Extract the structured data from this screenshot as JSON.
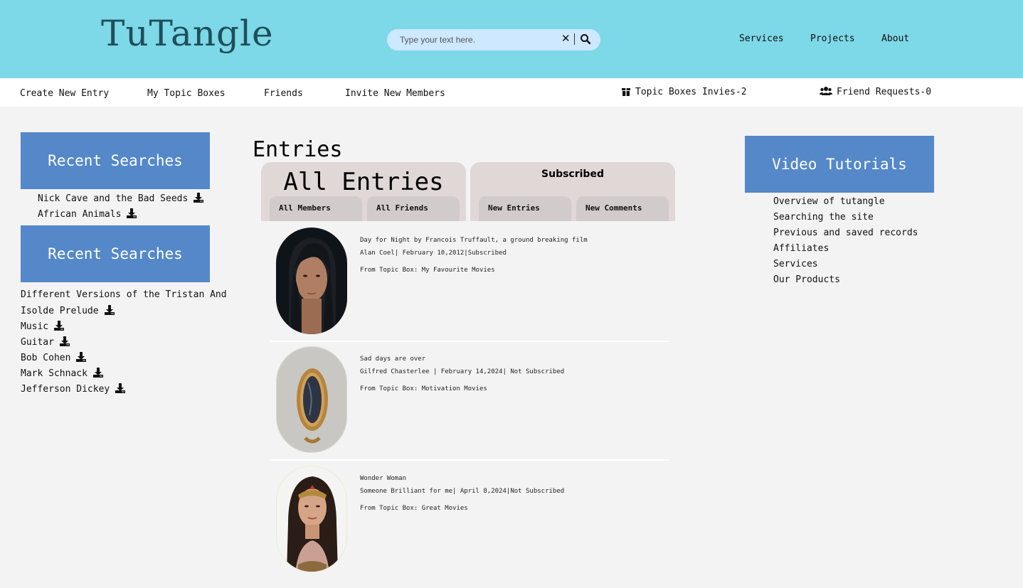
{
  "header": {
    "logo": "TuTangle",
    "search_placeholder": "Type your text here.",
    "nav": [
      "Services",
      "Projects",
      "About"
    ]
  },
  "subnav": {
    "create": "Create New Entry",
    "my_topic_boxes": "My Topic Boxes",
    "friends": "Friends",
    "invite": "Invite New Members",
    "topic_invites": "Topic Boxes Invies-2",
    "friend_requests": "Friend Requests-0"
  },
  "left": {
    "box1_title": "Recent Searches",
    "box1_items": [
      "Nick Cave and the Bad Seeds",
      "African Animals"
    ],
    "box2_title": "Recent Searches",
    "box2_items": [
      "Different Versions of the Tristan And",
      "Isolde Prelude",
      "Music",
      "Guitar",
      "Bob Cohen",
      "Mark Schnack",
      "Jefferson Dickey"
    ]
  },
  "entries": {
    "heading": "Entries",
    "panel_all": "All Entries",
    "panel_subscribed": "Subscribed",
    "tabs": [
      "All Members",
      "All Friends",
      "New Entries",
      "New Comments"
    ],
    "items": [
      {
        "title": "Day for Night by Francois Truffault, a ground breaking film",
        "meta": "Alan Coel| February 10,2012|Subscribed",
        "from": "From Topic Box: My Favourite Movies"
      },
      {
        "title": "Sad days are over",
        "meta": "Gilfred Chasterlee | February 14,2024| Not Subscribed",
        "from": "From Topic Box: Motivation Movies"
      },
      {
        "title": "Wonder Woman",
        "meta": "Someone Brilliant for me| April 8,2024|Not Subscribed",
        "from": "From Topic Box: Great Movies"
      }
    ]
  },
  "right": {
    "title": "Video Tutorials",
    "links": [
      "Overview of tutangle",
      "Searching the site",
      "Previous and saved records",
      "Affiliates",
      "Services",
      "Our Products"
    ]
  },
  "colors": {
    "header_bg": "#7dd8e8",
    "accent_blue": "#5488c8",
    "panel_bg": "#e0d7d7",
    "page_bg": "#f3f3f3"
  }
}
